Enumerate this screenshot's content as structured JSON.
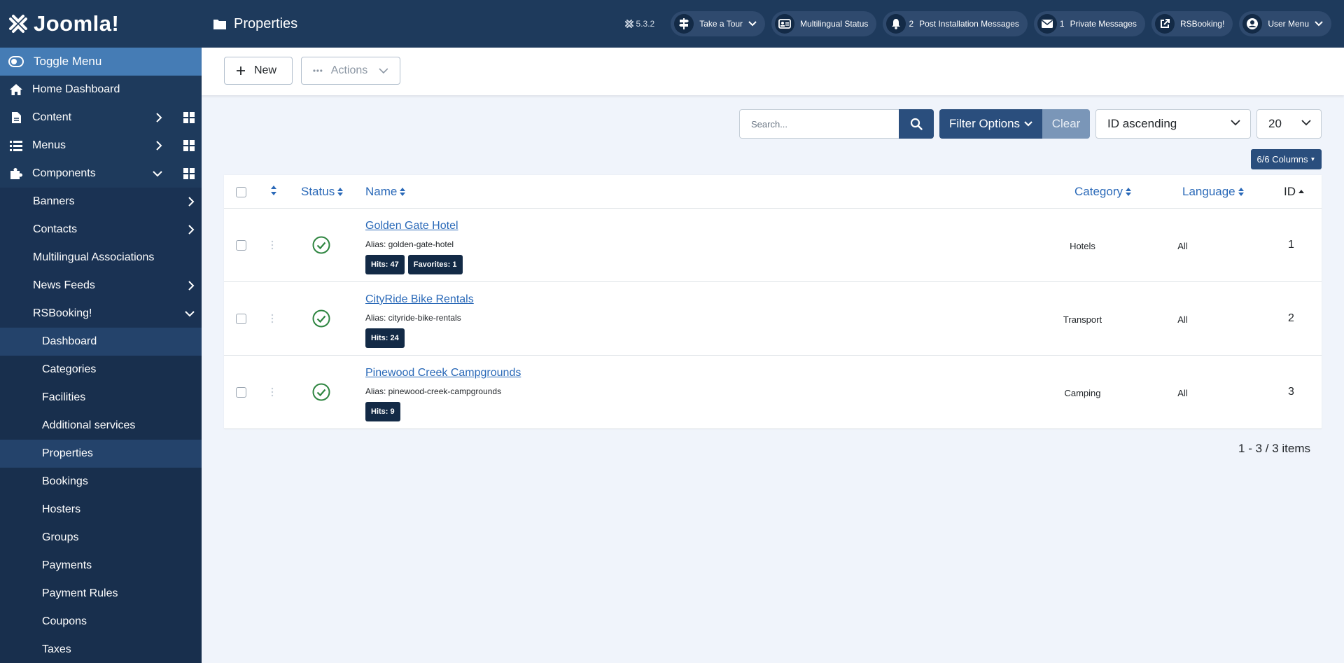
{
  "brand": {
    "name": "Joomla!"
  },
  "sidebar": {
    "toggle": "Toggle Menu",
    "items": [
      {
        "label": "Home Dashboard",
        "icon": "home-icon"
      },
      {
        "label": "Content",
        "icon": "file-icon"
      },
      {
        "label": "Menus",
        "icon": "list-icon"
      },
      {
        "label": "Components",
        "icon": "puzzle-icon"
      }
    ],
    "components": [
      {
        "label": "Banners"
      },
      {
        "label": "Contacts"
      },
      {
        "label": "Multilingual Associations"
      },
      {
        "label": "News Feeds"
      },
      {
        "label": "RSBooking!"
      }
    ],
    "rsbooking": [
      {
        "label": "Dashboard"
      },
      {
        "label": "Categories"
      },
      {
        "label": "Facilities"
      },
      {
        "label": "Additional services"
      },
      {
        "label": "Properties"
      },
      {
        "label": "Bookings"
      },
      {
        "label": "Hosters"
      },
      {
        "label": "Groups"
      },
      {
        "label": "Payments"
      },
      {
        "label": "Payment Rules"
      },
      {
        "label": "Coupons"
      },
      {
        "label": "Taxes"
      }
    ]
  },
  "header": {
    "title": "Properties",
    "version": "5.3.2",
    "pills": {
      "tour": "Take a Tour",
      "multilingual": "Multilingual Status",
      "postinstall": "Post Installation Messages",
      "postinstall_count": "2",
      "private": "Private Messages",
      "private_count": "1",
      "rsbooking": "RSBooking!",
      "user": "User Menu"
    }
  },
  "toolbar": {
    "new": "New",
    "actions": "Actions"
  },
  "filters": {
    "search_placeholder": "Search...",
    "filter_options": "Filter Options",
    "clear": "Clear",
    "ordering": "ID ascending",
    "limit": "20",
    "columns": "6/6 Columns"
  },
  "table": {
    "headers": {
      "status": "Status",
      "name": "Name",
      "category": "Category",
      "language": "Language",
      "id": "ID"
    },
    "rows": [
      {
        "name": "Golden Gate Hotel",
        "alias": "Alias: golden-gate-hotel",
        "hits": "Hits: 47",
        "favorites": "Favorites: 1",
        "category": "Hotels",
        "language": "All",
        "id": "1"
      },
      {
        "name": "CityRide Bike Rentals",
        "alias": "Alias: cityride-bike-rentals",
        "hits": "Hits: 24",
        "category": "Transport",
        "language": "All",
        "id": "2"
      },
      {
        "name": "Pinewood Creek Campgrounds",
        "alias": "Alias: pinewood-creek-campgrounds",
        "hits": "Hits: 9",
        "category": "Camping",
        "language": "All",
        "id": "3"
      }
    ]
  },
  "pager": "1 - 3 / 3 items",
  "colors": {
    "sidebar": "#1e3a5c",
    "accent": "#2a4e7d",
    "link": "#2a69b8",
    "success": "#2e8540"
  }
}
